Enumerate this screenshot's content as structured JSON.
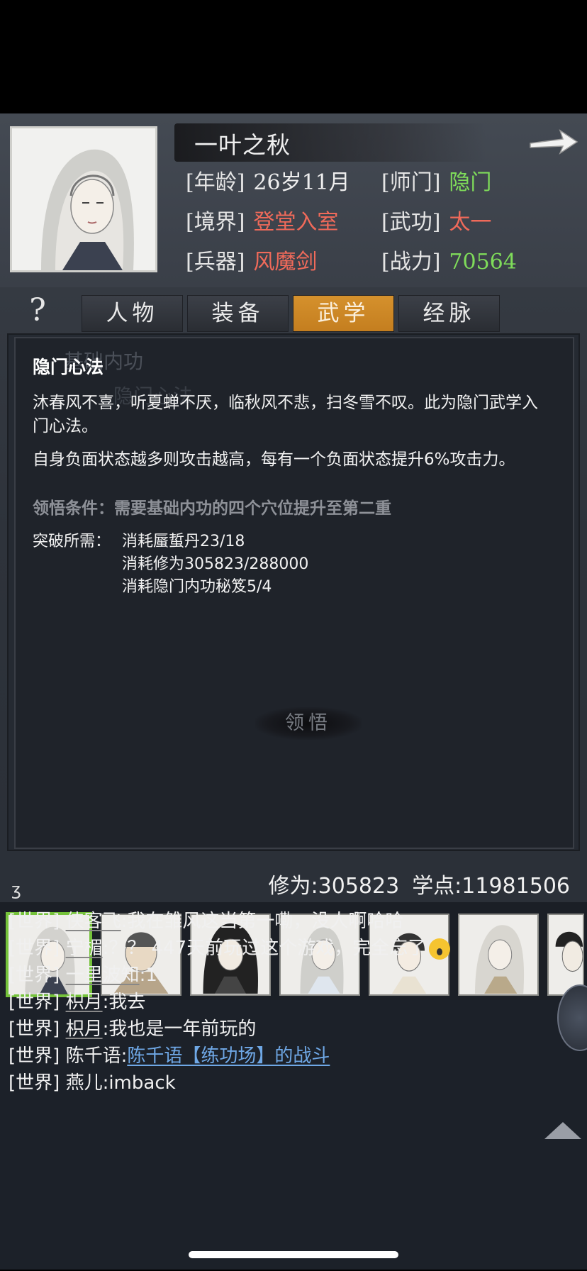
{
  "character": {
    "name": "一叶之秋",
    "stats": [
      {
        "label": "[年龄]",
        "value": "26岁11月",
        "color": "#eeeeee"
      },
      {
        "label": "[师门]",
        "value": "隐门",
        "color": "#7fdc5a"
      },
      {
        "label": "[境界]",
        "value": "登堂入室",
        "color": "#f06a5a"
      },
      {
        "label": "[武功]",
        "value": "太一",
        "color": "#f06a5a"
      },
      {
        "label": "[兵器]",
        "value": "风魔剑",
        "color": "#f06a5a"
      },
      {
        "label": "[战力]",
        "value": "70564",
        "color": "#7fdc5a"
      }
    ]
  },
  "help_icon": "?",
  "tabs": [
    {
      "label": "人物",
      "active": false
    },
    {
      "label": "装备",
      "active": false
    },
    {
      "label": "武学",
      "active": true
    },
    {
      "label": "经脉",
      "active": false
    }
  ],
  "panel": {
    "bg_item_1": "基础内功",
    "bg_item_2": "隐门心法",
    "title": "隐门心法",
    "description_1": "沐春风不喜，听夏蝉不厌，临秋风不悲，扫冬雪不叹。此为隐门武学入门心法。",
    "description_2": "自身负面状态越多则攻击越高，每有一个负面状态提升6%攻击力。",
    "condition": "领悟条件：需要基础内功的四个穴位提升至第二重",
    "requirement_label": "突破所需：",
    "requirements": [
      "消耗蜃蜇丹23/18",
      "消耗修为305823/288000",
      "消耗隐门内功秘笈5/4"
    ],
    "learn_button": "领悟"
  },
  "points": {
    "cultivation": "修为:305823",
    "study": "学点:11981506"
  },
  "team_icons": [
    "portrait-icon",
    "portrait-icon",
    "portrait-icon",
    "portrait-icon",
    "portrait-icon",
    "portrait-icon",
    "portrait-icon"
  ],
  "chat": {
    "tilde": "ʒ",
    "messages": [
      {
        "channel": "[世界]",
        "user": "侠客飞",
        "text": ":我在雏风这当第一嘞，没人啊哈哈"
      },
      {
        "channel": "[世界]",
        "user": "宁楣",
        "text": ":？？ 447天前玩过这个游戏，完全忘了",
        "emoji": "scream-emoji"
      },
      {
        "channel": "[世界]",
        "user": "一里波知",
        "text": ":1"
      },
      {
        "channel": "[世界]",
        "user": "枳月",
        "text": ":我去"
      },
      {
        "channel": "[世界]",
        "user": "枳月",
        "text": ":我也是一年前玩的"
      },
      {
        "channel": "[世界]",
        "user": "陈千语",
        "text": ":",
        "link": "陈千语【练功场】的战斗"
      },
      {
        "channel": "[世界]",
        "user": "燕儿",
        "text": ":imback"
      }
    ]
  },
  "colors": {
    "active_tab": "#d08a28",
    "link": "#6fa8e6",
    "green": "#7fdc5a",
    "red": "#f06a5a"
  }
}
